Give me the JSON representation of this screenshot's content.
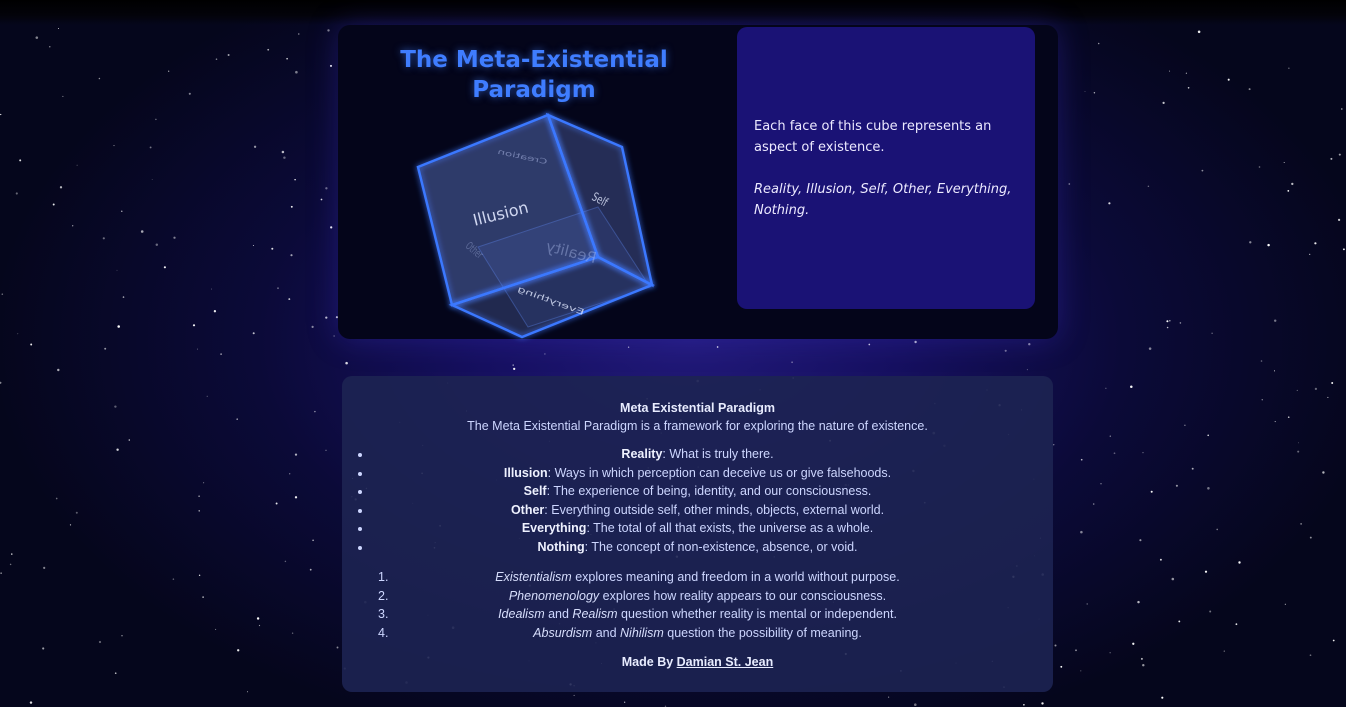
{
  "hero": {
    "title": "The Meta-Existential Paradigm",
    "cube_faces": {
      "front": "Illusion",
      "right": "Self",
      "top": "Creation",
      "bottom": "Everything",
      "back": "Reality",
      "left": "Other"
    },
    "info_text": "Each face of this cube represents an aspect of existence.",
    "info_aspects": "Reality, Illusion, Self, Other, Everything, Nothing."
  },
  "about": {
    "title": "Meta Existential Paradigm",
    "intro": "The Meta Existential Paradigm is a framework for exploring the nature of existence.",
    "aspects": [
      {
        "term": "Reality",
        "desc": ": What is truly there."
      },
      {
        "term": "Illusion",
        "desc": ": Ways in which perception can deceive us or give falsehoods."
      },
      {
        "term": "Self",
        "desc": ": The experience of being, identity, and our consciousness."
      },
      {
        "term": "Other",
        "desc": ": Everything outside self, other minds, objects, external world."
      },
      {
        "term": "Everything",
        "desc": ": The total of all that exists, the universe as a whole."
      },
      {
        "term": "Nothing",
        "desc": ": The concept of non-existence, absence, or void."
      }
    ],
    "philosophies": [
      {
        "num": "1.",
        "a": "Existentialism",
        "and": "",
        "b": "",
        "rest": " explores meaning and freedom in a world without purpose."
      },
      {
        "num": "2.",
        "a": "Phenomenology",
        "and": "",
        "b": "",
        "rest": " explores how reality appears to our consciousness."
      },
      {
        "num": "3.",
        "a": "Idealism",
        "and": " and ",
        "b": "Realism",
        "rest": " question whether reality is mental or independent."
      },
      {
        "num": "4.",
        "a": "Absurdism",
        "and": " and ",
        "b": "Nihilism",
        "rest": " question the possibility of meaning."
      }
    ],
    "credit_prefix": "Made By ",
    "credit_author": "Damian St. Jean"
  },
  "colors": {
    "accent": "#3f7dff",
    "panel": "#1a1275",
    "hero_bg": "#04051a",
    "about_bg": "#1d2352"
  }
}
